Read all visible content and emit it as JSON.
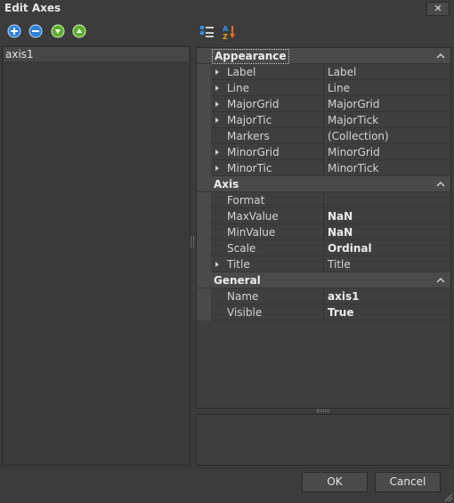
{
  "window": {
    "title": "Edit Axes",
    "close_label": "✕"
  },
  "toolbar": {
    "add_icon": "plus-circle-icon",
    "remove_icon": "minus-circle-icon",
    "move_down_icon": "arrow-down-circle-icon",
    "move_up_icon": "arrow-up-circle-icon"
  },
  "axes_list": {
    "items": [
      "axis1"
    ]
  },
  "grid_toolbar": {
    "categorized_icon": "categorized-view-icon",
    "alphabetical_icon": "alphabetical-sort-icon"
  },
  "properties": {
    "appearance": {
      "label": "Appearance",
      "rows": [
        {
          "name": "Label",
          "value": "Label"
        },
        {
          "name": "Line",
          "value": "Line"
        },
        {
          "name": "MajorGrid",
          "value": "MajorGrid"
        },
        {
          "name": "MajorTic",
          "value": "MajorTick"
        },
        {
          "name": "Markers",
          "value": "(Collection)"
        },
        {
          "name": "MinorGrid",
          "value": "MinorGrid"
        },
        {
          "name": "MinorTic",
          "value": "MinorTick"
        }
      ]
    },
    "axis": {
      "label": "Axis",
      "rows": [
        {
          "name": "Format",
          "value": ""
        },
        {
          "name": "MaxValue",
          "value": "NaN"
        },
        {
          "name": "MinValue",
          "value": "NaN"
        },
        {
          "name": "Scale",
          "value": "Ordinal"
        },
        {
          "name": "Title",
          "value": "Title"
        }
      ]
    },
    "general": {
      "label": "General",
      "rows": [
        {
          "name": "Name",
          "value": "axis1"
        },
        {
          "name": "Visible",
          "value": "True"
        }
      ]
    }
  },
  "buttons": {
    "ok": "OK",
    "cancel": "Cancel"
  },
  "colors": {
    "background": "#3c3c3c",
    "panel": "#3f3f3f",
    "accent_blue": "#3a8ee6",
    "accent_green": "#6cc03a"
  }
}
